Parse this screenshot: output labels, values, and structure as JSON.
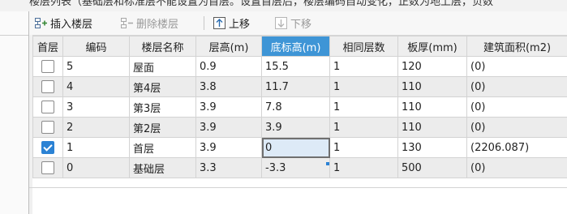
{
  "header": {
    "cut_text": "楼层列表（基础层和标准层不能设置为首层。设置首层后，楼层编码自动变化，正数为地上层，负数"
  },
  "toolbar": {
    "insert_floor": "插入楼层",
    "delete_floor": "删除楼层",
    "move_up": "上移",
    "move_down": "下移"
  },
  "table": {
    "columns": [
      "首层",
      "编码",
      "楼层名称",
      "层高(m)",
      "底标高(m)",
      "相同层数",
      "板厚(mm)",
      "建筑面积(m2)"
    ],
    "selected_column": "底标高(m)",
    "rows": [
      {
        "first": false,
        "code": "5",
        "name": "屋面",
        "height": "0.9",
        "bottom": "15.5",
        "same": "1",
        "thick": "120",
        "area": "(0)"
      },
      {
        "first": false,
        "code": "4",
        "name": "第4层",
        "height": "3.8",
        "bottom": "11.7",
        "same": "1",
        "thick": "110",
        "area": "(0)"
      },
      {
        "first": false,
        "code": "3",
        "name": "第3层",
        "height": "3.9",
        "bottom": "7.8",
        "same": "1",
        "thick": "110",
        "area": "(0)"
      },
      {
        "first": false,
        "code": "2",
        "name": "第2层",
        "height": "3.9",
        "bottom": "3.9",
        "same": "1",
        "thick": "110",
        "area": "(0)"
      },
      {
        "first": true,
        "code": "1",
        "name": "首层",
        "height": "3.9",
        "bottom": "0",
        "same": "1",
        "thick": "130",
        "area": "(2206.087)"
      },
      {
        "first": false,
        "code": "0",
        "name": "基础层",
        "height": "3.3",
        "bottom": "-3.3",
        "same": "1",
        "thick": "500",
        "area": "(0)"
      }
    ]
  },
  "colors": {
    "accent": "#3e95d6",
    "checkbox_checked": "#2b82d4",
    "edit_cell": "#ddeaf7",
    "alt_row": "#ececec"
  }
}
